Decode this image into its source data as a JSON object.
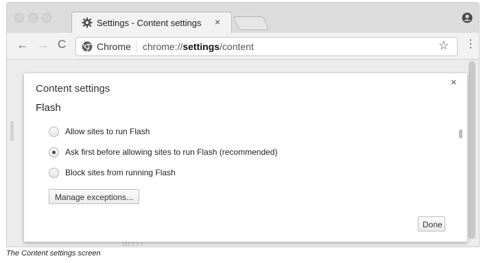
{
  "tab": {
    "title": "Settings - Content settings",
    "close_glyph": "×"
  },
  "toolbar": {
    "back_glyph": "←",
    "forward_glyph": "→",
    "reload_glyph": "C",
    "omnibox": {
      "chip": "Chrome",
      "url_prefix": "chrome://",
      "url_host": "settings",
      "url_path": "/content"
    },
    "star_glyph": "☆",
    "menu_glyph": "⋮"
  },
  "dialog": {
    "title": "Content settings",
    "close_glyph": "×",
    "section_title": "Flash",
    "options": [
      {
        "label": "Allow sites to run Flash",
        "checked": false
      },
      {
        "label": "Ask first before allowing sites to run Flash (recommended)",
        "checked": true
      },
      {
        "label": "Block sites from running Flash",
        "checked": false
      }
    ],
    "manage_button": "Manage exceptions...",
    "done_button": "Done"
  },
  "page": {
    "faint_text": "W l      t  t"
  },
  "caption": "The Content settings screen",
  "colors": {
    "tabstrip": "#dcdcdc",
    "toolbar": "#f2f2f2",
    "page_bg": "#ececec",
    "dialog_bg": "#ffffff"
  },
  "icons": [
    "gear-icon",
    "profile-icon",
    "chrome-icon",
    "star-icon",
    "menu-icon",
    "close-icon"
  ]
}
